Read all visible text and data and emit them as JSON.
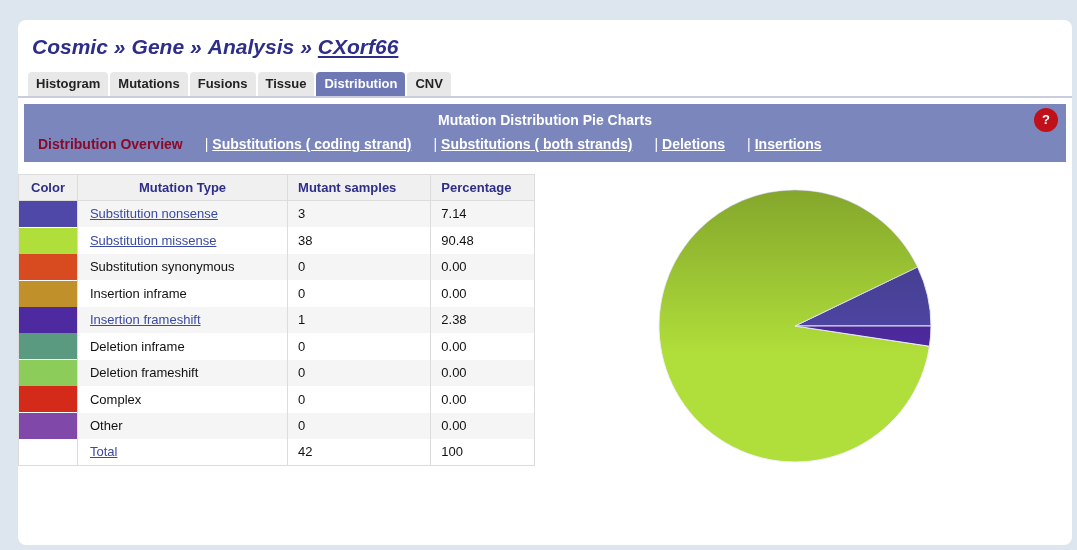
{
  "breadcrumb": [
    {
      "label": "Cosmic",
      "link": false
    },
    {
      "label": "Gene",
      "link": false
    },
    {
      "label": "Analysis",
      "link": false
    },
    {
      "label": "CXorf66",
      "link": true
    }
  ],
  "breadcrumb_separator": "»",
  "tabs": [
    {
      "label": "Histogram",
      "selected": false
    },
    {
      "label": "Mutations",
      "selected": false
    },
    {
      "label": "Fusions",
      "selected": false
    },
    {
      "label": "Tissue",
      "selected": false
    },
    {
      "label": "Distribution",
      "selected": true
    },
    {
      "label": "CNV",
      "selected": false
    }
  ],
  "panel": {
    "title": "Mutation Distribution Pie Charts",
    "help": "?",
    "links": [
      {
        "label": "Distribution Overview",
        "selected": true
      },
      {
        "label": "Substitutions ( coding strand)",
        "selected": false
      },
      {
        "label": "Substitutions ( both strands)",
        "selected": false
      },
      {
        "label": "Deletions",
        "selected": false
      },
      {
        "label": "Insertions",
        "selected": false
      }
    ],
    "link_separator": "|"
  },
  "table": {
    "columns": [
      "Color",
      "Mutation Type",
      "Mutant samples",
      "Percentage"
    ],
    "rows": [
      {
        "color": "#5048a8",
        "type": "Substitution nonsense",
        "link": true,
        "samples": "3",
        "percentage": "7.14"
      },
      {
        "color": "#b0de3a",
        "type": "Substitution missense",
        "link": true,
        "samples": "38",
        "percentage": "90.48"
      },
      {
        "color": "#d84a20",
        "type": "Substitution synonymous",
        "link": false,
        "samples": "0",
        "percentage": "0.00"
      },
      {
        "color": "#c0902a",
        "type": "Insertion inframe",
        "link": false,
        "samples": "0",
        "percentage": "0.00"
      },
      {
        "color": "#4e2aa0",
        "type": "Insertion frameshift",
        "link": true,
        "samples": "1",
        "percentage": "2.38"
      },
      {
        "color": "#5a9a80",
        "type": "Deletion inframe",
        "link": false,
        "samples": "0",
        "percentage": "0.00"
      },
      {
        "color": "#8ccc5a",
        "type": "Deletion frameshift",
        "link": false,
        "samples": "0",
        "percentage": "0.00"
      },
      {
        "color": "#d42a1a",
        "type": "Complex",
        "link": false,
        "samples": "0",
        "percentage": "0.00"
      },
      {
        "color": "#8048a8",
        "type": "Other",
        "link": false,
        "samples": "0",
        "percentage": "0.00"
      },
      {
        "type": "Total",
        "link": true,
        "samples": "42",
        "percentage": "100"
      }
    ]
  }
}
